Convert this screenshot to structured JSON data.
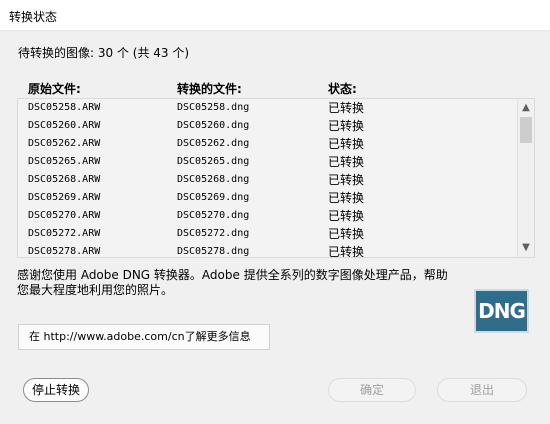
{
  "window": {
    "title": "转换状态"
  },
  "pending_text": "待转换的图像: 30 个 (共 43 个)",
  "columns": {
    "original": "原始文件:",
    "converted": "转换的文件:",
    "status": "状态:"
  },
  "rows": [
    {
      "original": "DSC05258.ARW",
      "converted": "DSC05258.dng",
      "status": "已转换"
    },
    {
      "original": "DSC05260.ARW",
      "converted": "DSC05260.dng",
      "status": "已转换"
    },
    {
      "original": "DSC05262.ARW",
      "converted": "DSC05262.dng",
      "status": "已转换"
    },
    {
      "original": "DSC05265.ARW",
      "converted": "DSC05265.dng",
      "status": "已转换"
    },
    {
      "original": "DSC05268.ARW",
      "converted": "DSC05268.dng",
      "status": "已转换"
    },
    {
      "original": "DSC05269.ARW",
      "converted": "DSC05269.dng",
      "status": "已转换"
    },
    {
      "original": "DSC05270.ARW",
      "converted": "DSC05270.dng",
      "status": "已转换"
    },
    {
      "original": "DSC05272.ARW",
      "converted": "DSC05272.dng",
      "status": "已转换"
    },
    {
      "original": "DSC05278.ARW",
      "converted": "DSC05278.dng",
      "status": "已转换"
    }
  ],
  "info_text": "感谢您使用 Adobe DNG 转换器。Adobe 提供全系列的数字图像处理产品，帮助您最大程度地利用您的照片。",
  "logo": {
    "text": "DNG",
    "color": "#2f6d8a"
  },
  "link_button": {
    "label": "在 http://www.adobe.com/cn了解更多信息"
  },
  "buttons": {
    "stop": "停止转换",
    "ok": "确定",
    "quit": "退出"
  },
  "icons": {
    "scroll_up": "triangle-up-icon",
    "scroll_down": "triangle-down-icon"
  }
}
